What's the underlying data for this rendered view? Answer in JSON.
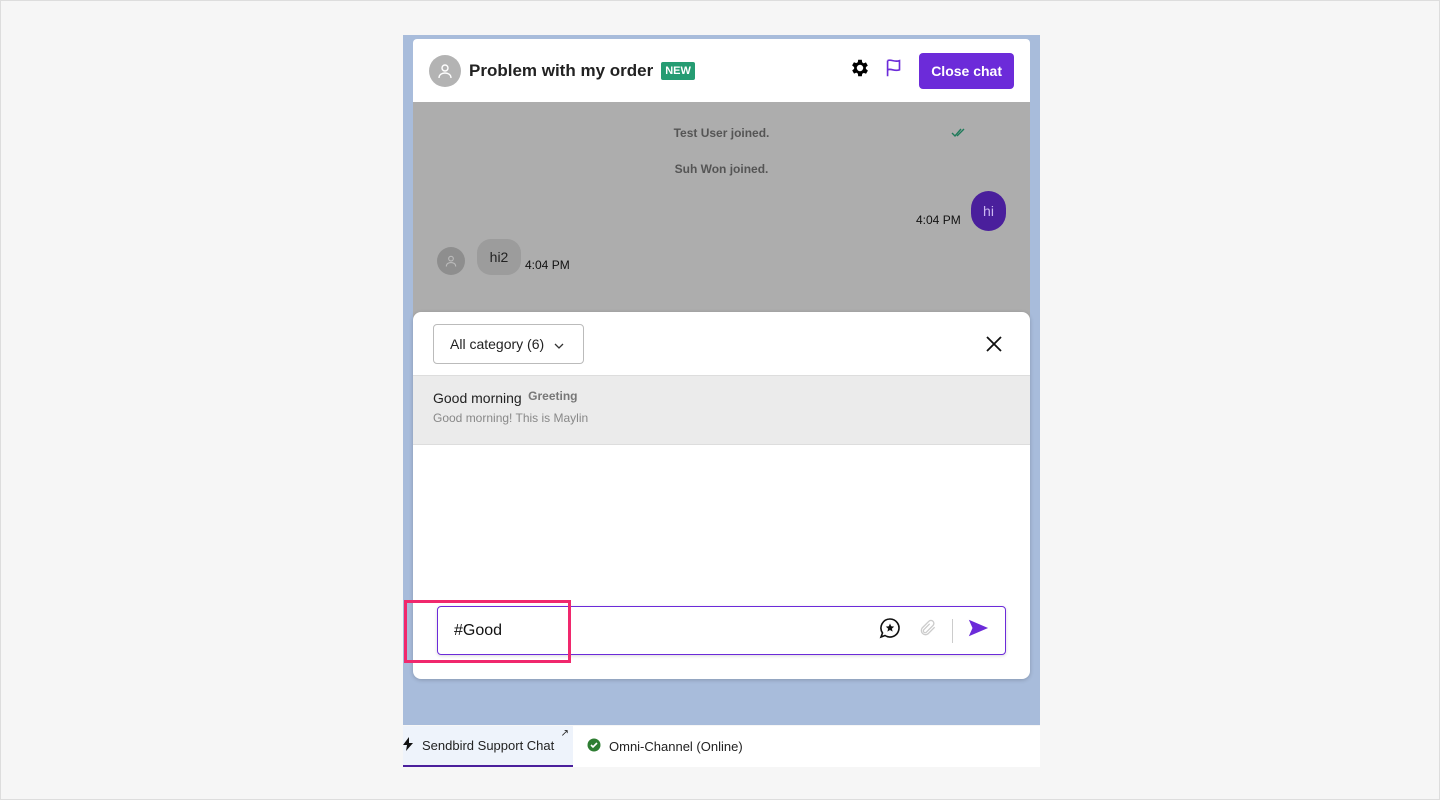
{
  "header": {
    "title": "Problem with my order",
    "badge": "NEW",
    "close_label": "Close chat",
    "icons": [
      "user-icon",
      "gear-icon",
      "flag-icon"
    ]
  },
  "messages": {
    "system": [
      "Test User joined.",
      "Suh Won joined."
    ],
    "outgoing": {
      "text": "hi",
      "time": "4:04 PM",
      "status": "read"
    },
    "incoming": {
      "text": "hi2",
      "time": "4:04 PM"
    }
  },
  "templates": {
    "category_label": "All category (6)",
    "items": [
      {
        "name": "Good morning",
        "category": "Greeting",
        "preview": "Good morning! This is Maylin"
      }
    ]
  },
  "composer": {
    "value": "#Good"
  },
  "bottom_bar": {
    "tab_label": "Sendbird Support Chat",
    "status_label": "Omni-Channel (Online)"
  },
  "colors": {
    "accent": "#6c2bd9",
    "badge": "#259c72",
    "highlight": "#f0286d",
    "online": "#2e7d32"
  }
}
